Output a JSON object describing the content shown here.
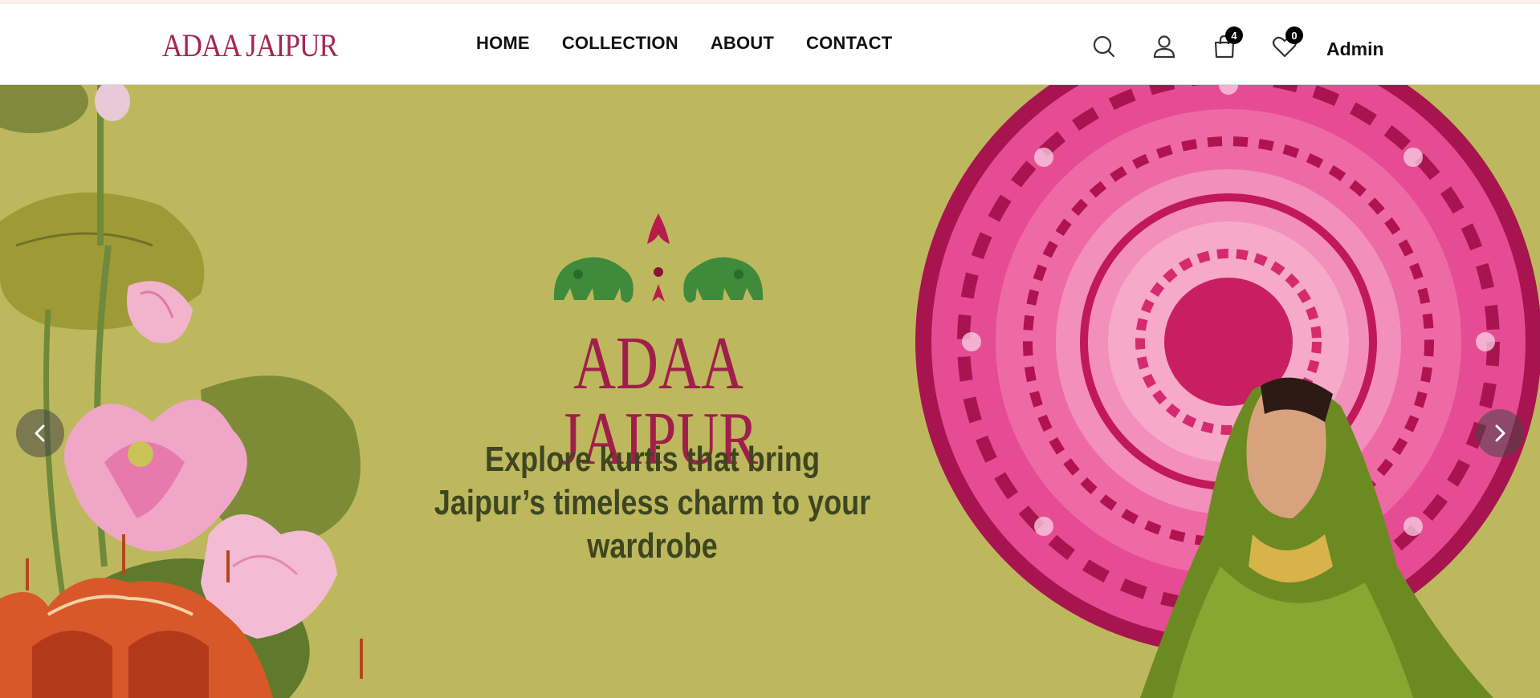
{
  "brand": {
    "name": "ADAA JAIPUR",
    "color": "#a4274f"
  },
  "nav": {
    "items": [
      {
        "label": "HOME"
      },
      {
        "label": "COLLECTION"
      },
      {
        "label": "ABOUT"
      },
      {
        "label": "CONTACT"
      }
    ]
  },
  "header_icons": {
    "search": "search-icon",
    "account": "user-icon",
    "cart": "shopping-bag-icon",
    "cart_count": "4",
    "wishlist": "heart-icon",
    "wishlist_count": "0"
  },
  "user": {
    "name": "Admin"
  },
  "hero": {
    "background_color": "#bdb85e",
    "brand": "ADAA JAIPUR",
    "tagline_line1": "Explore kurtis that bring",
    "tagline_line2": "Jaipur’s timeless charm to your wardrobe",
    "prev_icon": "chevron-left-icon",
    "next_icon": "chevron-right-icon"
  }
}
